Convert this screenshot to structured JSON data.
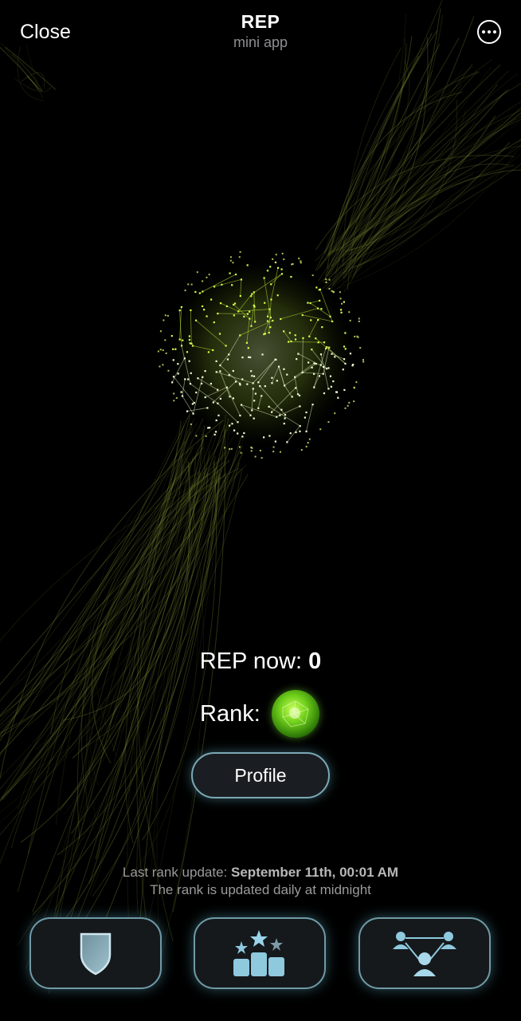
{
  "header": {
    "close_label": "Close",
    "title": "REP",
    "subtitle": "mini app",
    "more_icon": "ellipsis-circle-icon"
  },
  "stats": {
    "rep_label": "REP now:",
    "rep_value": "0",
    "rank_label": "Rank:",
    "rank_icon": "green-orb-rank-icon"
  },
  "actions": {
    "profile_label": "Profile"
  },
  "update": {
    "prefix": "Last rank update:",
    "timestamp": "September 11th, 00:01 AM",
    "note": "The rank is updated daily at midnight"
  },
  "nav": {
    "items": [
      {
        "icon": "shield-icon"
      },
      {
        "icon": "leaderboard-stars-icon"
      },
      {
        "icon": "referral-network-icon"
      }
    ]
  },
  "colors": {
    "accent_green": "#b8f03a",
    "button_border": "#7aa9b6",
    "background": "#000000"
  }
}
